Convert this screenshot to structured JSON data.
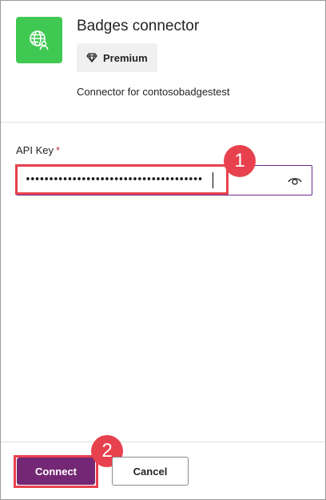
{
  "connector": {
    "title": "Badges connector",
    "premium_label": "Premium",
    "description": "Connector for contosobadgestest",
    "icon": "globe-person-icon",
    "icon_bg": "#3fc952"
  },
  "form": {
    "api_key_label": "API Key",
    "required_marker": "*",
    "api_key_value": "••••••••••••••••••••••••••••••••••••••"
  },
  "callouts": {
    "step1": "1",
    "step2": "2",
    "color": "#e8414e"
  },
  "footer": {
    "connect_label": "Connect",
    "cancel_label": "Cancel",
    "connect_color": "#742774"
  }
}
